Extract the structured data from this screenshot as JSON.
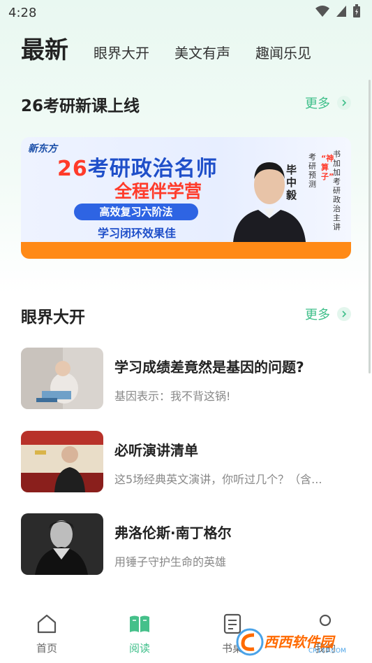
{
  "status_bar": {
    "time": "4:28"
  },
  "top_tabs": {
    "active": "最新",
    "items": [
      "眼界大开",
      "美文有声",
      "趣闻乐见"
    ]
  },
  "course_section": {
    "title": "26考研新课上线",
    "more": "更多",
    "banner": {
      "logo": "新东方",
      "title_num": "26",
      "title_rest": "考研政治名师",
      "subtitle": "全程伴学营",
      "pill": "高效复习六阶法",
      "pill2": "学习闭环效果佳",
      "teacher_name": "毕中毅",
      "side_text_1": "考研预测",
      "side_text_2": "“神算子”",
      "side_text_3": "书加加考研政治主讲"
    }
  },
  "vision_section": {
    "title": "眼界大开",
    "more": "更多",
    "articles": [
      {
        "title": "学习成绩差竟然是基因的问题?",
        "subtitle": "基因表示：我不背这锅!"
      },
      {
        "title": "必听演讲清单",
        "subtitle": "这5场经典英文演讲，你听过几个？（含..."
      },
      {
        "title": "弗洛伦斯·南丁格尔",
        "subtitle": "用锤子守护生命的英雄"
      }
    ]
  },
  "bottom_nav": {
    "items": [
      {
        "label": "首页",
        "icon": "home-icon"
      },
      {
        "label": "阅读",
        "icon": "book-icon",
        "active": true
      },
      {
        "label": "书桌",
        "icon": "notebook-icon"
      },
      {
        "label": "我的",
        "icon": "profile-icon"
      }
    ]
  },
  "watermark": {
    "text": "西西软件园",
    "sub": "CR173.COM"
  },
  "colors": {
    "accent": "#3fbf8a",
    "banner_orange": "#ff8a16",
    "banner_blue": "#1f4fc9"
  }
}
